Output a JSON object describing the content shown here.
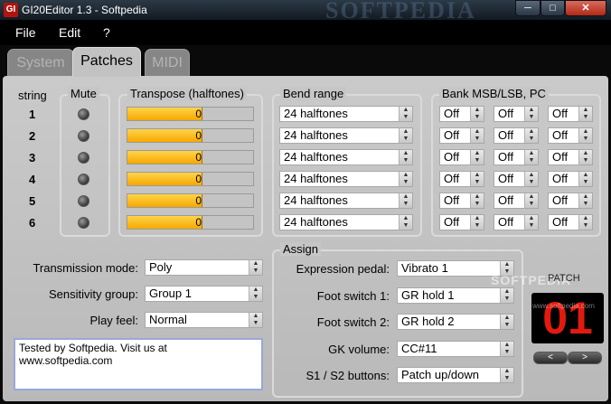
{
  "window": {
    "title": "GI20Editor 1.3 - Softpedia",
    "watermark": "SOFTPEDIA",
    "icon_text": "GI"
  },
  "caption": {
    "minimize": "─",
    "maximize": "□",
    "close": "✕"
  },
  "menu": [
    "File",
    "Edit",
    "?"
  ],
  "tabs": [
    {
      "label": "System",
      "active": false
    },
    {
      "label": "Patches",
      "active": true
    },
    {
      "label": "MIDI",
      "active": false
    }
  ],
  "headers": {
    "string": "string",
    "mute": "Mute",
    "transpose": "Transpose (halftones)",
    "bend": "Bend range",
    "bank": "Bank MSB/LSB, PC",
    "assign": "Assign"
  },
  "strings": [
    {
      "num": "1",
      "transpose": "0",
      "bend": "24 halftones",
      "msb": "Off",
      "lsb": "Off",
      "pc": "Off"
    },
    {
      "num": "2",
      "transpose": "0",
      "bend": "24 halftones",
      "msb": "Off",
      "lsb": "Off",
      "pc": "Off"
    },
    {
      "num": "3",
      "transpose": "0",
      "bend": "24 halftones",
      "msb": "Off",
      "lsb": "Off",
      "pc": "Off"
    },
    {
      "num": "4",
      "transpose": "0",
      "bend": "24 halftones",
      "msb": "Off",
      "lsb": "Off",
      "pc": "Off"
    },
    {
      "num": "5",
      "transpose": "0",
      "bend": "24 halftones",
      "msb": "Off",
      "lsb": "Off",
      "pc": "Off"
    },
    {
      "num": "6",
      "transpose": "0",
      "bend": "24 halftones",
      "msb": "Off",
      "lsb": "Off",
      "pc": "Off"
    }
  ],
  "transpose_fill_fraction": 0.6,
  "left_settings": [
    {
      "label": "Transmission mode:",
      "value": "Poly"
    },
    {
      "label": "Sensitivity group:",
      "value": "Group 1"
    },
    {
      "label": "Play feel:",
      "value": "Normal"
    }
  ],
  "assign": [
    {
      "label": "Expression pedal:",
      "value": "Vibrato 1"
    },
    {
      "label": "Foot switch 1:",
      "value": "GR hold 1"
    },
    {
      "label": "Foot switch 2:",
      "value": "GR hold 2"
    },
    {
      "label": "GK volume:",
      "value": "CC#11"
    },
    {
      "label": "S1 / S2 buttons:",
      "value": "Patch up/down"
    }
  ],
  "memo": {
    "line1": "Tested by Softpedia. Visit us at",
    "line2": "www.softpedia.com"
  },
  "patch": {
    "title": "PATCH",
    "number": "01",
    "prev": "<",
    "next": ">"
  },
  "watermark2": {
    "brand": "SOFTPEDIA",
    "url": "www.softpedia.com"
  },
  "colors": {
    "slider_fill": "#f6a800",
    "patch_digits": "#e21a0e",
    "close_button": "#b12a18"
  }
}
